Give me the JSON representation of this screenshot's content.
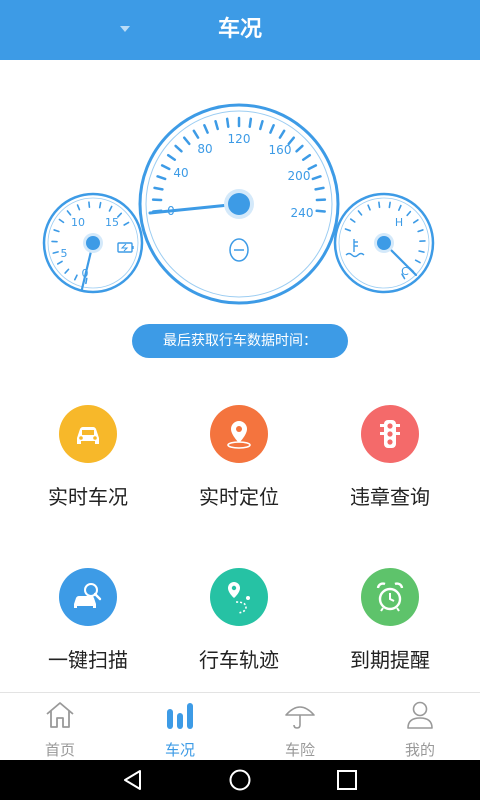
{
  "header": {
    "title": "车况"
  },
  "dashboard": {
    "speedometer": {
      "ticks": [
        "0",
        "40",
        "80",
        "120",
        "160",
        "200",
        "240"
      ],
      "reading": 0
    },
    "tachometer": {
      "ticks": [
        "0",
        "5",
        "10",
        "15"
      ]
    },
    "temperature": {
      "hot_label": "H",
      "cold_label": "C"
    }
  },
  "last_data_time": {
    "label": "最后获取行车数据时间："
  },
  "features": [
    {
      "label": "实时车况",
      "icon": "car-icon",
      "color": "#f7b82a"
    },
    {
      "label": "实时定位",
      "icon": "location-pin-icon",
      "color": "#f4743e"
    },
    {
      "label": "违章查询",
      "icon": "traffic-light-icon",
      "color": "#f46a6a"
    },
    {
      "label": "一键扫描",
      "icon": "car-scan-icon",
      "color": "#3d9be6"
    },
    {
      "label": "行车轨迹",
      "icon": "route-icon",
      "color": "#26c2a4"
    },
    {
      "label": "到期提醒",
      "icon": "alarm-clock-icon",
      "color": "#5ec36b"
    }
  ],
  "tabs": [
    {
      "label": "首页",
      "icon": "home-icon",
      "active": false
    },
    {
      "label": "车况",
      "icon": "bar-chart-icon",
      "active": true
    },
    {
      "label": "车险",
      "icon": "umbrella-icon",
      "active": false
    },
    {
      "label": "我的",
      "icon": "user-icon",
      "active": false
    }
  ],
  "colors": {
    "primary": "#3d9be6",
    "inactive": "#999999"
  }
}
